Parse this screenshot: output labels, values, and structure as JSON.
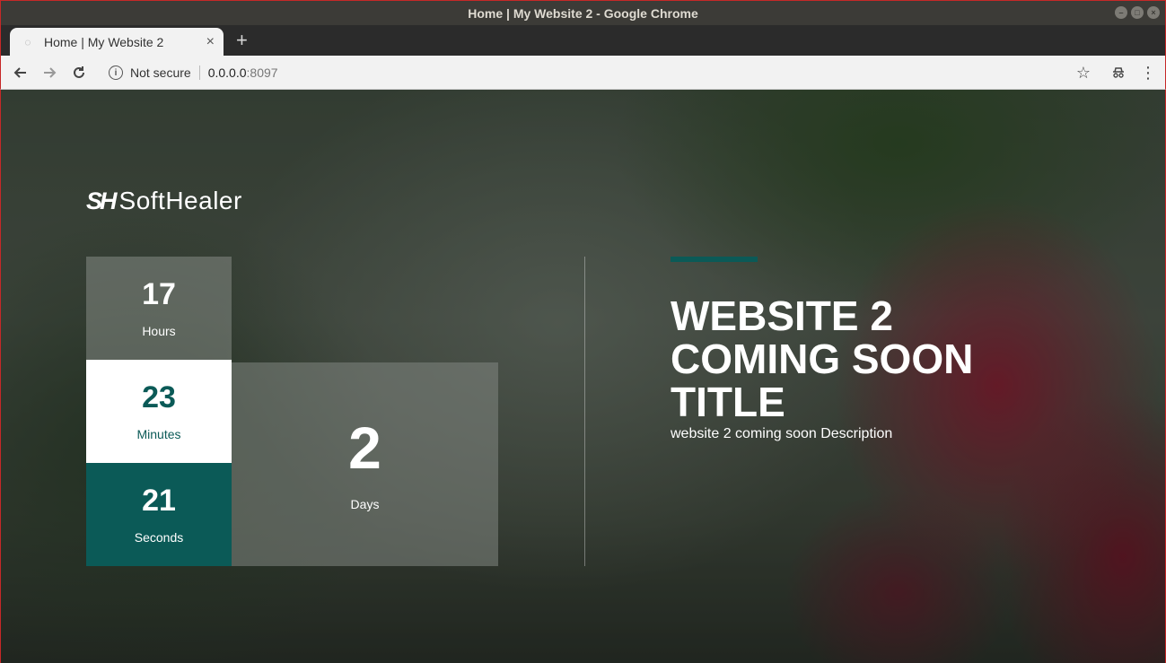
{
  "window": {
    "title": "Home | My Website 2 - Google Chrome"
  },
  "tab": {
    "title": "Home | My Website 2",
    "close": "×",
    "new_tab": "+"
  },
  "toolbar": {
    "security_label": "Not secure",
    "url_host": "0.0.0.0",
    "url_port": ":8097"
  },
  "page": {
    "logo": {
      "mark": "SH",
      "word": "SoftHealer"
    },
    "countdown": {
      "hours": {
        "value": "17",
        "label": "Hours"
      },
      "minutes": {
        "value": "23",
        "label": "Minutes"
      },
      "seconds": {
        "value": "21",
        "label": "Seconds"
      },
      "days": {
        "value": "2",
        "label": "Days"
      }
    },
    "headline_lines": [
      "WEBSITE 2",
      "COMING SOON",
      "TITLE"
    ],
    "description": "website 2 coming soon Description"
  },
  "colors": {
    "accent": "#0b5a57",
    "minutes_bg": "#ffffff",
    "seconds_bg": "#0b5a57"
  }
}
